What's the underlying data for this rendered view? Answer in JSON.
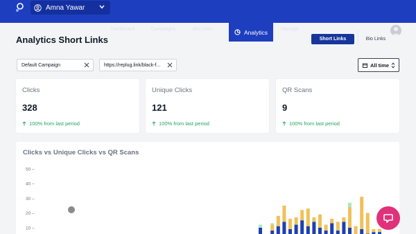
{
  "header": {
    "user_name": "Amna Yawar",
    "nav_items": [
      "Dashboard",
      "Campaigns",
      "Bio Links",
      "Replug Links",
      "Manage",
      "Reports"
    ],
    "active_tab": "Analytics"
  },
  "page": {
    "title": "Analytics Short Links",
    "toggle": {
      "short_links": "Short Links",
      "bio_links": "Bio Links"
    }
  },
  "filters": {
    "campaign": "Default Campaign",
    "link": "https://replug.link/black-f...",
    "time_range": "All time"
  },
  "stats": [
    {
      "title": "Clicks",
      "value": "328",
      "change": "100% from last period"
    },
    {
      "title": "Unique Clicks",
      "value": "121",
      "change": "100% from last period"
    },
    {
      "title": "QR Scans",
      "value": "9",
      "change": "100% from last period"
    }
  ],
  "colors": {
    "brand": "#1d3fbf",
    "clicks": "#1e40af",
    "unique_clicks": "#f0c15a",
    "qr_scans": "#a7e8c4",
    "positive": "#22a55a",
    "fab": "#e0317a"
  },
  "chart_data": {
    "type": "bar",
    "title": "Clicks vs Unique Clicks vs QR Scans",
    "y_ticks": [
      "50",
      "40",
      "30",
      "20",
      "10"
    ],
    "ylim": [
      0,
      50
    ],
    "stacked": true,
    "series": [
      {
        "name": "Clicks",
        "values": [
          10,
          3,
          8,
          11,
          14,
          9,
          12,
          15,
          11,
          14,
          10,
          8,
          13,
          8,
          14,
          10,
          4,
          9,
          6,
          7,
          7
        ]
      },
      {
        "name": "Unique Clicks",
        "values": [
          0,
          1,
          4,
          7,
          11,
          7,
          5,
          7,
          12,
          3,
          9,
          4,
          3,
          6,
          3,
          14,
          7,
          22,
          14,
          2,
          2
        ]
      },
      {
        "name": "QR Scans",
        "values": [
          2,
          0,
          1,
          0,
          0,
          0,
          0,
          0,
          0,
          0,
          0,
          0,
          0,
          0,
          0,
          3,
          0,
          0,
          0,
          0,
          0
        ]
      }
    ],
    "partial_point": 20,
    "grid": false,
    "legend": "none"
  },
  "icons": {
    "logo": "replug-logo-icon",
    "user": "user-circle-icon",
    "chevron": "chevron-down-icon",
    "analytics": "pie-chart-icon",
    "clear": "close-icon",
    "calendar": "calendar-icon",
    "sort": "up-down-icon",
    "trend": "arrow-up-icon",
    "chat": "chat-bubble-icon"
  }
}
